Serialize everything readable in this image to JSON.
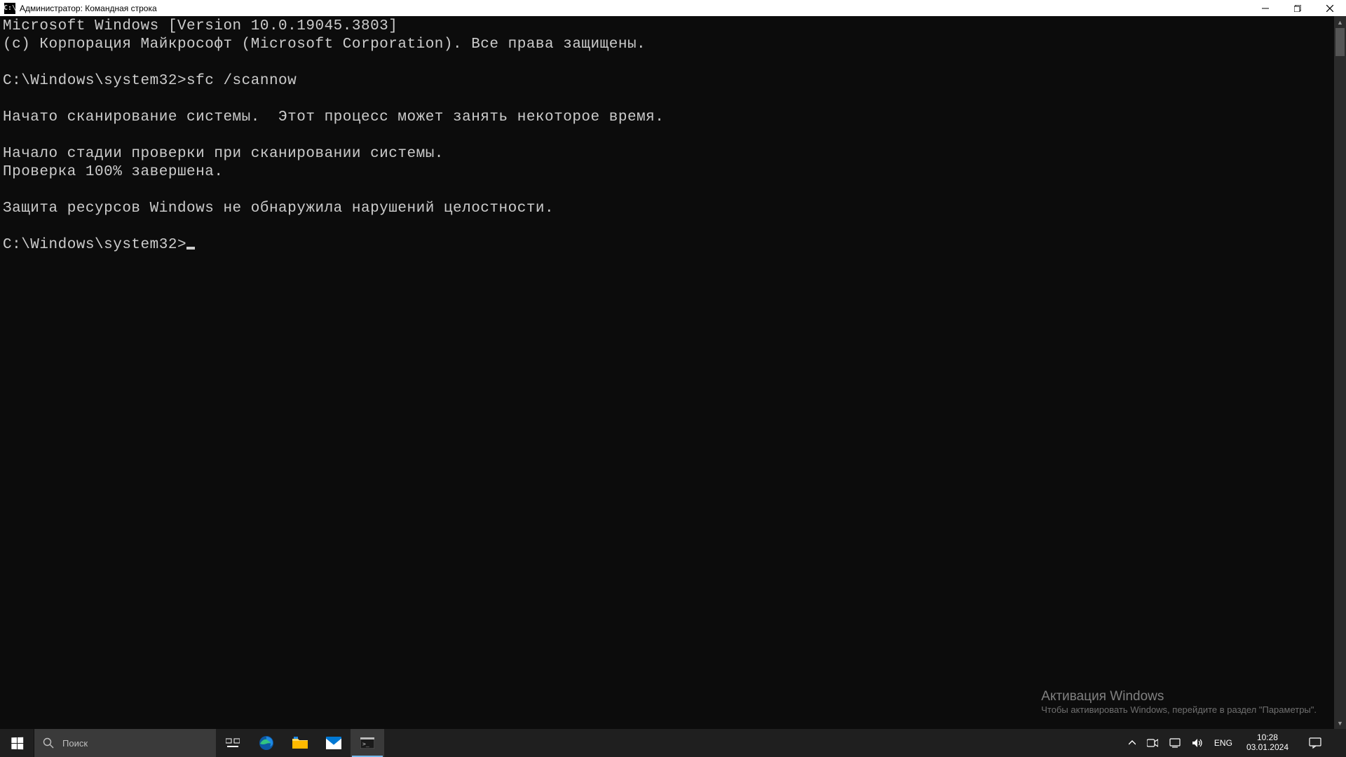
{
  "window": {
    "title": "Администратор: Командная строка",
    "icon_label": "C:\\"
  },
  "terminal": {
    "lines": [
      "Microsoft Windows [Version 10.0.19045.3803]",
      "(c) Корпорация Майкрософт (Microsoft Corporation). Все права защищены.",
      "",
      "C:\\Windows\\system32>sfc /scannow",
      "",
      "Начато сканирование системы.  Этот процесс может занять некоторое время.",
      "",
      "Начало стадии проверки при сканировании системы.",
      "Проверка 100% завершена.",
      "",
      "Защита ресурсов Windows не обнаружила нарушений целостности.",
      "",
      "C:\\Windows\\system32>"
    ]
  },
  "watermark": {
    "title": "Активация Windows",
    "subtitle": "Чтобы активировать Windows, перейдите в раздел \"Параметры\"."
  },
  "taskbar": {
    "search_placeholder": "Поиск",
    "lang": "ENG",
    "time": "10:28",
    "date": "03.01.2024"
  }
}
